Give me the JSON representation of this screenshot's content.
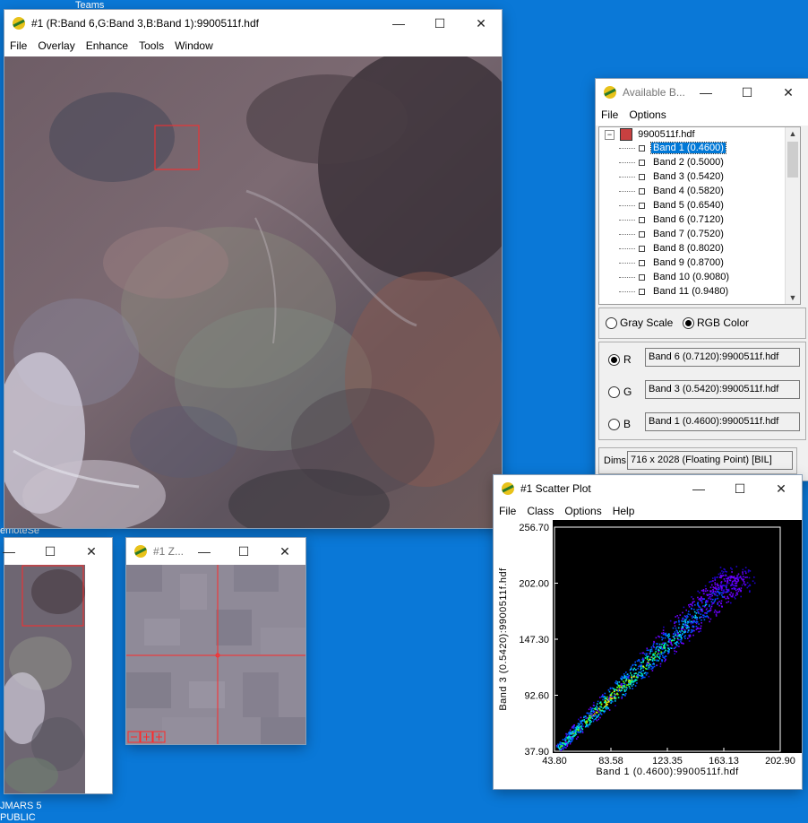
{
  "desktop": {
    "labels": [
      "Teams",
      "emoteSe",
      "JMARS 5",
      "PUBLIC"
    ]
  },
  "main_image_window": {
    "title": "#1 (R:Band 6,G:Band 3,B:Band 1):9900511f.hdf",
    "menu": [
      "File",
      "Overlay",
      "Enhance",
      "Tools",
      "Window"
    ]
  },
  "available_bands": {
    "title": "Available B...",
    "menu": [
      "File",
      "Options"
    ],
    "file_name": "9900511f.hdf",
    "bands": [
      "Band 1 (0.4600)",
      "Band 2 (0.5000)",
      "Band 3 (0.5420)",
      "Band 4 (0.5820)",
      "Band 5 (0.6540)",
      "Band 6 (0.7120)",
      "Band 7 (0.7520)",
      "Band 8 (0.8020)",
      "Band 9 (0.8700)",
      "Band 10 (0.9080)",
      "Band 11 (0.9480)"
    ],
    "selected_band_index": 0,
    "mode_gray": "Gray Scale",
    "mode_rgb": "RGB Color",
    "selected_mode": "RGB Color",
    "r_label": "R",
    "g_label": "G",
    "b_label": "B",
    "r_value": "Band 6 (0.7120):9900511f.hdf",
    "g_value": "Band 3 (0.5420):9900511f.hdf",
    "b_value": "Band 1 (0.4600):9900511f.hdf",
    "dims_label": "Dims",
    "dims_value": "716 x 2028 (Floating Point) [BIL]"
  },
  "zoom_window": {
    "title": "#1 Z..."
  },
  "scatter_plot": {
    "title": "#1 Scatter Plot",
    "menu": [
      "File",
      "Class",
      "Options",
      "Help"
    ]
  },
  "chart_data": {
    "type": "scatter",
    "title": "",
    "xlabel": "Band 1 (0.4600):9900511f.hdf",
    "ylabel": "Band 3 (0.5420):9900511f.hdf",
    "xlim": [
      43.8,
      202.9
    ],
    "ylim": [
      37.9,
      256.7
    ],
    "x_ticks": [
      "43.80",
      "83.58",
      "123.35",
      "163.13",
      "202.90"
    ],
    "y_ticks": [
      "37.90",
      "92.60",
      "147.30",
      "202.00",
      "256.70"
    ],
    "density_cloud": {
      "trend_x": [
        47,
        60,
        75,
        90,
        105,
        120,
        135,
        150,
        165,
        175
      ],
      "trend_y": [
        42,
        60,
        80,
        100,
        120,
        140,
        160,
        180,
        200,
        210
      ]
    },
    "background": "#000000",
    "colors": [
      "#1e00c8",
      "#6a00ff",
      "#0050ff",
      "#00c8ff",
      "#00ffb4",
      "#64ff00",
      "#ffff00",
      "#ff8c00",
      "#ff0000"
    ]
  },
  "colors": {
    "desktop_blue": "#0a78d7",
    "selection": "#0078d7",
    "roi_red": "#ff2a2a"
  }
}
